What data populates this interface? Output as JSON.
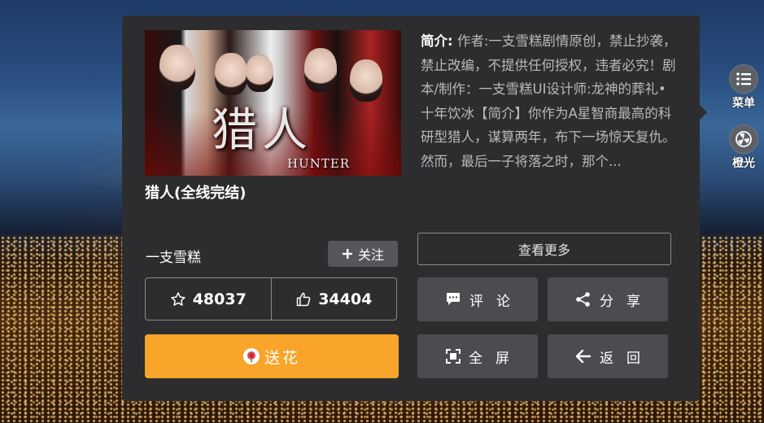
{
  "side_menu": {
    "menu_label": "菜单",
    "light_label": "橙光"
  },
  "book": {
    "cover_title": "猎人",
    "cover_subtitle": "HUNTER",
    "title": "猎人(全线完结)",
    "intro_label": "简介:",
    "intro_text": "作者:一支雪糕剧情原创，禁止抄袭，禁止改编，不提供任何授权，违者必究！剧本/制作：一支雪糕UI设计师:龙神的葬礼•十年饮冰【简介】你作为A星智商最高的科研型猎人，谋算两年，布下一场惊天复仇。然而，最后一子将落之时，那个...",
    "author": "一支雪糕"
  },
  "buttons": {
    "follow": "关注",
    "more": "查看更多",
    "flower": "送花",
    "comment": "评论",
    "share": "分享",
    "fullscreen": "全屏",
    "back": "返回"
  },
  "stats": {
    "favorites": "48037",
    "likes": "34404"
  },
  "colors": {
    "panel_bg": "#2d2d2f",
    "button_bg": "#4b4c50",
    "accent_orange": "#f8a52a"
  }
}
